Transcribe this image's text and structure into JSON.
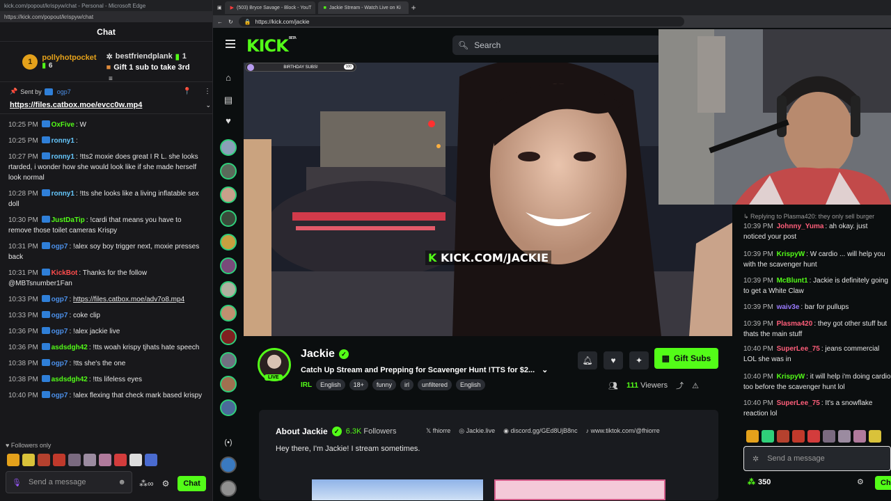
{
  "left_window": {
    "title_bar": "kick.com/popout/krispyw/chat - Personal - Microsoft Edge",
    "url": "https://kick.com/popout/krispyw/chat",
    "chat_title": "Chat",
    "leaderboard": [
      {
        "rank": "1",
        "name": "pollyhotpocket",
        "count": "6"
      },
      {
        "rank": "",
        "name": "bestfriendplank",
        "count": "1",
        "action": "Gift 1 sub to take 3rd"
      }
    ],
    "pinned": {
      "sent_by_label": "Sent by",
      "sender": "ogp7",
      "link": "https://files.catbox.moe/evcc0w.mp4"
    },
    "messages": [
      {
        "time": "10:25 PM",
        "user": "OxFive",
        "color": "#53fc18",
        "text": "W"
      },
      {
        "time": "10:25 PM",
        "user": "ronny1",
        "color": "#66c8ff",
        "text": ""
      },
      {
        "time": "10:27 PM",
        "user": "ronny1",
        "color": "#66c8ff",
        "text": "!tts2 moxie does great I R L. she looks rtarded, i wonder how she would look like if she made herself look normal"
      },
      {
        "time": "10:28 PM",
        "user": "ronny1",
        "color": "#66c8ff",
        "text": "!tts she looks like a living inflatable sex doll"
      },
      {
        "time": "10:30 PM",
        "user": "JustDaTip",
        "color": "#53fc18",
        "text": "!cardi that means you have to remove those toilet cameras Krispy"
      },
      {
        "time": "10:31 PM",
        "user": "ogp7",
        "color": "#4b8fe8",
        "text": "!alex soy boy trigger next, moxie presses back"
      },
      {
        "time": "10:31 PM",
        "user": "KickBot",
        "color": "#ff4d4d",
        "text": "Thanks for the follow @MBTsnumber1Fan"
      },
      {
        "time": "10:33 PM",
        "user": "ogp7",
        "color": "#4b8fe8",
        "text": "https://files.catbox.moe/adv7o8.mp4",
        "link": true
      },
      {
        "time": "10:33 PM",
        "user": "ogp7",
        "color": "#4b8fe8",
        "text": "coke clip"
      },
      {
        "time": "10:36 PM",
        "user": "ogp7",
        "color": "#4b8fe8",
        "text": "!alex jackie live"
      },
      {
        "time": "10:36 PM",
        "user": "asdsdgh42",
        "color": "#53fc18",
        "text": "!tts woah krispy tjhats hate speech"
      },
      {
        "time": "10:38 PM",
        "user": "ogp7",
        "color": "#4b8fe8",
        "text": "!tts she's the one"
      },
      {
        "time": "10:38 PM",
        "user": "asdsdgh42",
        "color": "#53fc18",
        "text": "!tts lifeless eyes"
      },
      {
        "time": "10:40 PM",
        "user": "ogp7",
        "color": "#4b8fe8",
        "text": "!alex flexing that check mark based krispy"
      }
    ],
    "followers_only": "Followers only",
    "input_placeholder": "Send a message",
    "chat_button": "Chat"
  },
  "main_window": {
    "tabs": [
      "(503) Bryce Savage - Block - YouT",
      "Jackie Stream - Watch Live on Ki"
    ],
    "url": "https://kick.com/jackie",
    "logo": "KICK",
    "logo_beta": "BETA",
    "search_placeholder": "Search",
    "goal": {
      "label": "BIRTHDAY SUBS!",
      "count": "100"
    },
    "watermark_k": "K",
    "watermark": "KICK.COM/JACKIE",
    "streamer": {
      "name": "Jackie",
      "live_label": "LIVE",
      "title": "Catch Up Stream and Prepping for Scavenger Hunt !TTS for $2...",
      "category": "IRL",
      "tags": [
        "English",
        "18+",
        "funny",
        "irl",
        "unfiltered",
        "English"
      ],
      "viewers_count": "111",
      "viewers_label": "Viewers",
      "gift_label": "Gift Subs"
    },
    "about": {
      "title": "About Jackie",
      "followers_count": "6.3K",
      "followers_label": "Followers",
      "links": [
        "fhiorre",
        "Jackie.live",
        "discord.gg/GEd8UjB8nc",
        "www.tiktok.com/@fhiorre"
      ],
      "bio": "Hey there, I'm Jackie! I stream sometimes."
    },
    "right_chat": {
      "reply_line": "Replying to Plasma420: they only sell burger",
      "messages": [
        {
          "time": "10:39 PM",
          "user": "Johnny_Yuma",
          "color": "#ff5e7a",
          "text": "ah okay. just noticed your post"
        },
        {
          "time": "10:39 PM",
          "user": "KrispyW",
          "color": "#53fc18",
          "text": "W cardio ... will help you with the scavenger hunt"
        },
        {
          "time": "10:39 PM",
          "user": "McBlunt1",
          "color": "#53fc18",
          "text": "Jackie is definitely going to get a White Claw"
        },
        {
          "time": "10:39 PM",
          "user": "waiv3e",
          "color": "#9b7bff",
          "text": "bar for pullups"
        },
        {
          "time": "10:39 PM",
          "user": "Plasma420",
          "color": "#ff5e7a",
          "text": "they got other stuff but thats the main stuff"
        },
        {
          "time": "10:40 PM",
          "user": "SuperLee_75",
          "color": "#ff5e7a",
          "text": "jeans commercial LOL she was in"
        },
        {
          "time": "10:40 PM",
          "user": "KrispyW",
          "color": "#53fc18",
          "text": "it will help i'm doing cardio too before the scavenger hunt lol"
        },
        {
          "time": "10:40 PM",
          "user": "SuperLee_75",
          "color": "#ff5e7a",
          "text": "It's a snowflake reaction lol"
        }
      ],
      "input_placeholder": "Send a message",
      "points": "350",
      "chat_button": "Chat"
    }
  }
}
